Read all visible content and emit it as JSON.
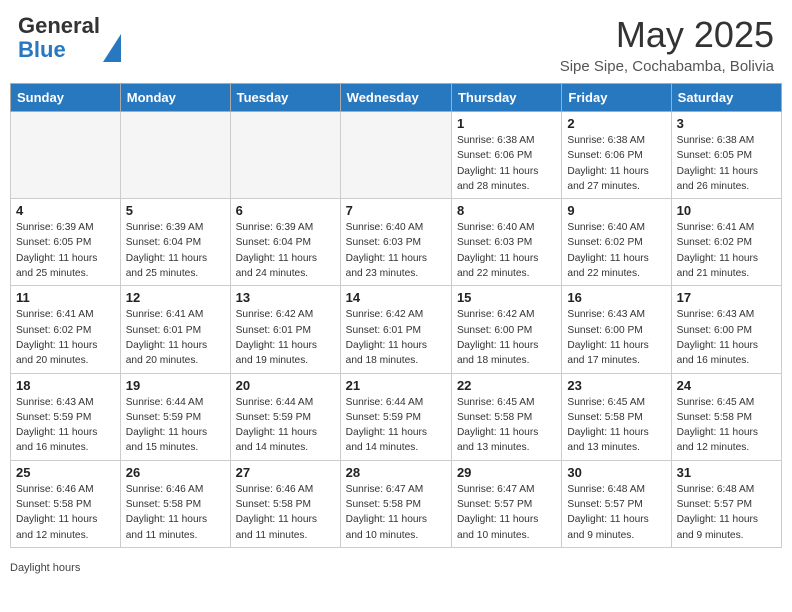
{
  "header": {
    "logo_line1": "General",
    "logo_line2": "Blue",
    "title": "May 2025",
    "subtitle": "Sipe Sipe, Cochabamba, Bolivia"
  },
  "calendar": {
    "days_of_week": [
      "Sunday",
      "Monday",
      "Tuesday",
      "Wednesday",
      "Thursday",
      "Friday",
      "Saturday"
    ],
    "weeks": [
      [
        {
          "day": "",
          "info": ""
        },
        {
          "day": "",
          "info": ""
        },
        {
          "day": "",
          "info": ""
        },
        {
          "day": "",
          "info": ""
        },
        {
          "day": "1",
          "info": "Sunrise: 6:38 AM\nSunset: 6:06 PM\nDaylight: 11 hours and 28 minutes."
        },
        {
          "day": "2",
          "info": "Sunrise: 6:38 AM\nSunset: 6:06 PM\nDaylight: 11 hours and 27 minutes."
        },
        {
          "day": "3",
          "info": "Sunrise: 6:38 AM\nSunset: 6:05 PM\nDaylight: 11 hours and 26 minutes."
        }
      ],
      [
        {
          "day": "4",
          "info": "Sunrise: 6:39 AM\nSunset: 6:05 PM\nDaylight: 11 hours and 25 minutes."
        },
        {
          "day": "5",
          "info": "Sunrise: 6:39 AM\nSunset: 6:04 PM\nDaylight: 11 hours and 25 minutes."
        },
        {
          "day": "6",
          "info": "Sunrise: 6:39 AM\nSunset: 6:04 PM\nDaylight: 11 hours and 24 minutes."
        },
        {
          "day": "7",
          "info": "Sunrise: 6:40 AM\nSunset: 6:03 PM\nDaylight: 11 hours and 23 minutes."
        },
        {
          "day": "8",
          "info": "Sunrise: 6:40 AM\nSunset: 6:03 PM\nDaylight: 11 hours and 22 minutes."
        },
        {
          "day": "9",
          "info": "Sunrise: 6:40 AM\nSunset: 6:02 PM\nDaylight: 11 hours and 22 minutes."
        },
        {
          "day": "10",
          "info": "Sunrise: 6:41 AM\nSunset: 6:02 PM\nDaylight: 11 hours and 21 minutes."
        }
      ],
      [
        {
          "day": "11",
          "info": "Sunrise: 6:41 AM\nSunset: 6:02 PM\nDaylight: 11 hours and 20 minutes."
        },
        {
          "day": "12",
          "info": "Sunrise: 6:41 AM\nSunset: 6:01 PM\nDaylight: 11 hours and 20 minutes."
        },
        {
          "day": "13",
          "info": "Sunrise: 6:42 AM\nSunset: 6:01 PM\nDaylight: 11 hours and 19 minutes."
        },
        {
          "day": "14",
          "info": "Sunrise: 6:42 AM\nSunset: 6:01 PM\nDaylight: 11 hours and 18 minutes."
        },
        {
          "day": "15",
          "info": "Sunrise: 6:42 AM\nSunset: 6:00 PM\nDaylight: 11 hours and 18 minutes."
        },
        {
          "day": "16",
          "info": "Sunrise: 6:43 AM\nSunset: 6:00 PM\nDaylight: 11 hours and 17 minutes."
        },
        {
          "day": "17",
          "info": "Sunrise: 6:43 AM\nSunset: 6:00 PM\nDaylight: 11 hours and 16 minutes."
        }
      ],
      [
        {
          "day": "18",
          "info": "Sunrise: 6:43 AM\nSunset: 5:59 PM\nDaylight: 11 hours and 16 minutes."
        },
        {
          "day": "19",
          "info": "Sunrise: 6:44 AM\nSunset: 5:59 PM\nDaylight: 11 hours and 15 minutes."
        },
        {
          "day": "20",
          "info": "Sunrise: 6:44 AM\nSunset: 5:59 PM\nDaylight: 11 hours and 14 minutes."
        },
        {
          "day": "21",
          "info": "Sunrise: 6:44 AM\nSunset: 5:59 PM\nDaylight: 11 hours and 14 minutes."
        },
        {
          "day": "22",
          "info": "Sunrise: 6:45 AM\nSunset: 5:58 PM\nDaylight: 11 hours and 13 minutes."
        },
        {
          "day": "23",
          "info": "Sunrise: 6:45 AM\nSunset: 5:58 PM\nDaylight: 11 hours and 13 minutes."
        },
        {
          "day": "24",
          "info": "Sunrise: 6:45 AM\nSunset: 5:58 PM\nDaylight: 11 hours and 12 minutes."
        }
      ],
      [
        {
          "day": "25",
          "info": "Sunrise: 6:46 AM\nSunset: 5:58 PM\nDaylight: 11 hours and 12 minutes."
        },
        {
          "day": "26",
          "info": "Sunrise: 6:46 AM\nSunset: 5:58 PM\nDaylight: 11 hours and 11 minutes."
        },
        {
          "day": "27",
          "info": "Sunrise: 6:46 AM\nSunset: 5:58 PM\nDaylight: 11 hours and 11 minutes."
        },
        {
          "day": "28",
          "info": "Sunrise: 6:47 AM\nSunset: 5:58 PM\nDaylight: 11 hours and 10 minutes."
        },
        {
          "day": "29",
          "info": "Sunrise: 6:47 AM\nSunset: 5:57 PM\nDaylight: 11 hours and 10 minutes."
        },
        {
          "day": "30",
          "info": "Sunrise: 6:48 AM\nSunset: 5:57 PM\nDaylight: 11 hours and 9 minutes."
        },
        {
          "day": "31",
          "info": "Sunrise: 6:48 AM\nSunset: 5:57 PM\nDaylight: 11 hours and 9 minutes."
        }
      ]
    ]
  },
  "footer": {
    "daylight_label": "Daylight hours"
  }
}
